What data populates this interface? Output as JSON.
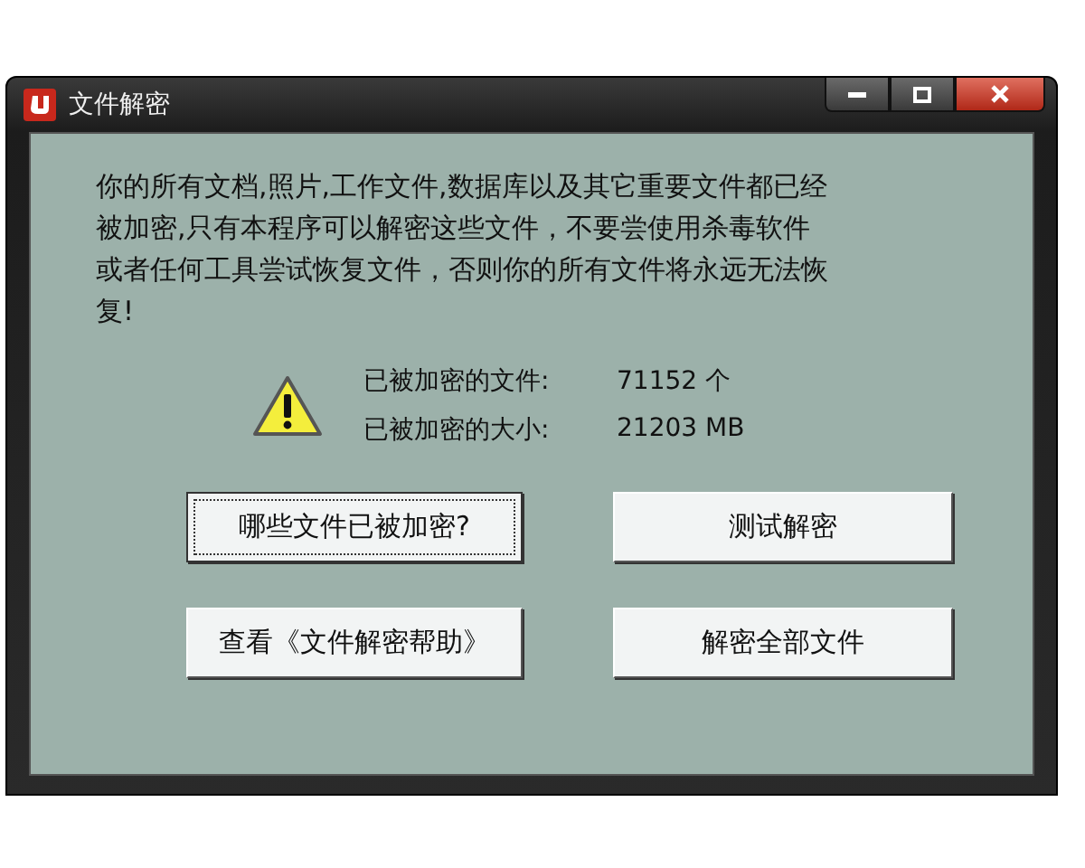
{
  "window": {
    "title": "文件解密"
  },
  "message": "你的所有文档,照片,工作文件,数据库以及其它重要文件都已经被加密,只有本程序可以解密这些文件，不要尝使用杀毒软件或者任何工具尝试恢复文件，否则你的所有文件将永远无法恢复!",
  "stats": [
    {
      "label": "已被加密的文件:",
      "value": "71152 个"
    },
    {
      "label": "已被加密的大小:",
      "value": "21203 MB"
    }
  ],
  "buttons": [
    {
      "label": "哪些文件已被加密?",
      "focused": true
    },
    {
      "label": "测试解密",
      "focused": false
    },
    {
      "label": "查看《文件解密帮助》",
      "focused": false
    },
    {
      "label": "解密全部文件",
      "focused": false
    }
  ]
}
